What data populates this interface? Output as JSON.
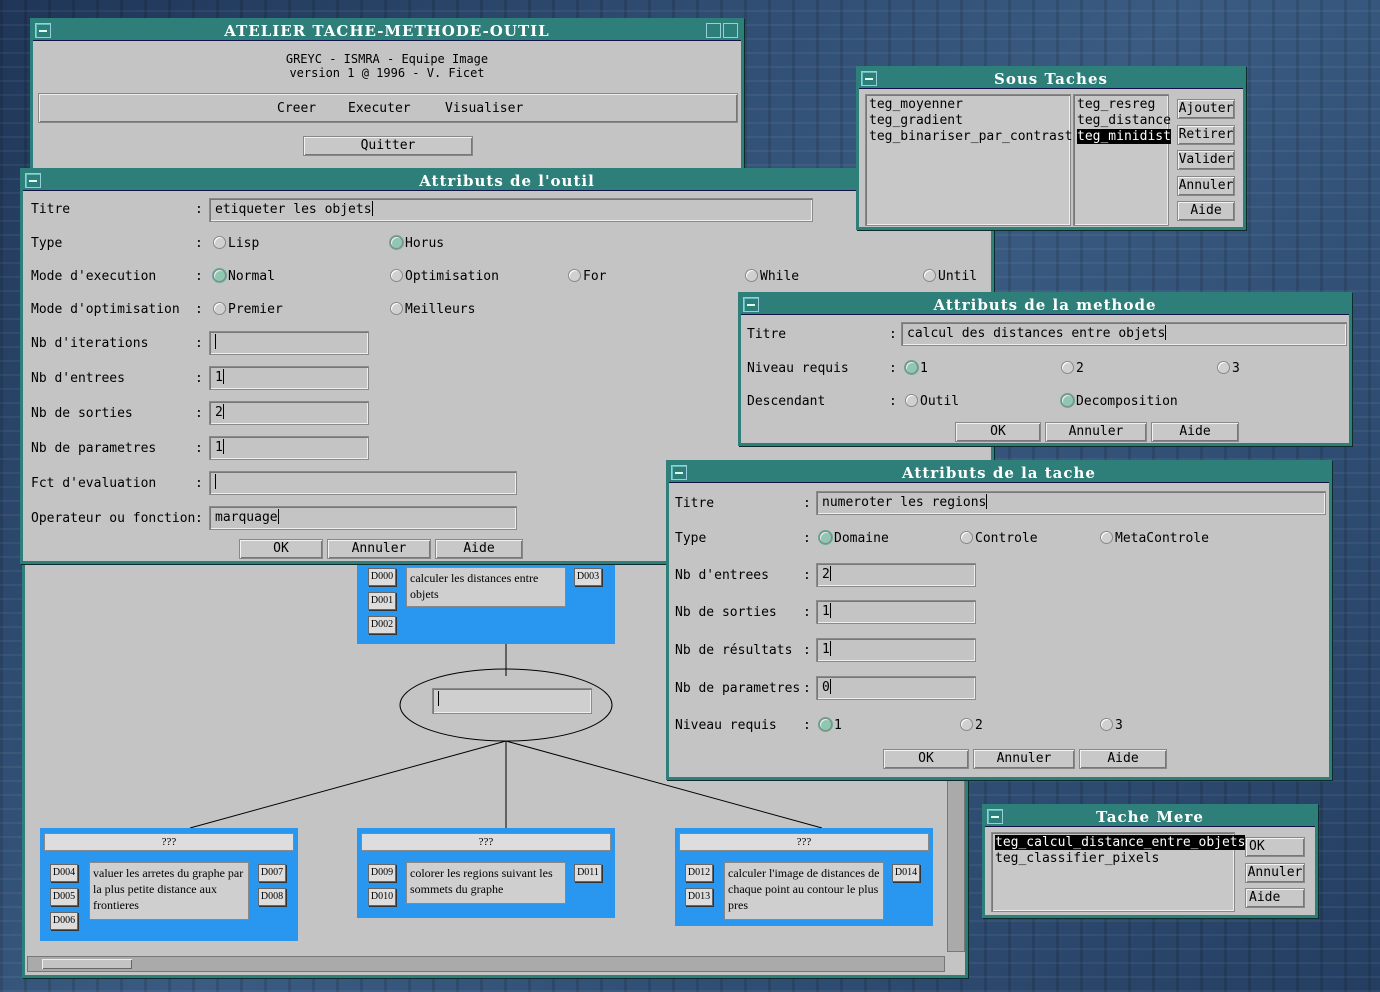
{
  "main_window": {
    "title": "ATELIER TACHE-METHODE-OUTIL",
    "line1": "GREYC - ISMRA - Equipe Image",
    "line2": "version 1 @ 1996 - V. Ficet",
    "menu": [
      "Creer",
      "Executer",
      "Visualiser"
    ],
    "quit": "Quitter"
  },
  "outil": {
    "title": "Attributs de l'outil",
    "labels": {
      "titre": "Titre",
      "type": "Type",
      "mode_exec": "Mode d'execution",
      "mode_opt": "Mode d'optimisation",
      "nb_iter": "Nb d'iterations",
      "nb_entrees": "Nb d'entrees",
      "nb_sorties": "Nb de sorties",
      "nb_params": "Nb de parametres",
      "fct_eval": "Fct d'evaluation",
      "operateur": "Operateur ou fonction"
    },
    "colon": ":",
    "values": {
      "titre": "etiqueter les objets",
      "nb_iter": "",
      "nb_entrees": "1",
      "nb_sorties": "2",
      "nb_params": "1",
      "fct_eval": "",
      "operateur": "marquage"
    },
    "type_opts": [
      "Lisp",
      "Horus"
    ],
    "exec_opts": [
      "Normal",
      "Optimisation",
      "For",
      "While",
      "Until"
    ],
    "opt_opts": [
      "Premier",
      "Meilleurs"
    ],
    "buttons": [
      "OK",
      "Annuler",
      "Aide"
    ]
  },
  "sous_taches": {
    "title": "Sous Taches",
    "left": [
      "teg_moyenner",
      "teg_gradient",
      "teg_binariser_par_contraste"
    ],
    "right": [
      "teg_resreg",
      "teg_distance",
      "teg_minidist"
    ],
    "buttons": [
      "Ajouter",
      "Retirer",
      "Valider",
      "Annuler",
      "Aide"
    ]
  },
  "methode": {
    "title": "Attributs de la methode",
    "labels": {
      "titre": "Titre",
      "niveau": "Niveau requis",
      "descendant": "Descendant"
    },
    "titre": "calcul des distances entre objets",
    "niveau_opts": [
      "1",
      "2",
      "3"
    ],
    "desc_opts": [
      "Outil",
      "Decomposition"
    ],
    "buttons": [
      "OK",
      "Annuler",
      "Aide"
    ]
  },
  "tache": {
    "title": "Attributs de la tache",
    "labels": {
      "titre": "Titre",
      "type": "Type",
      "nb_entrees": "Nb d'entrees",
      "nb_sorties": "Nb de sorties",
      "nb_resultats": "Nb de résultats",
      "nb_params": "Nb de parametres",
      "niveau": "Niveau requis"
    },
    "values": {
      "titre": "numeroter les regions",
      "nb_entrees": "2",
      "nb_sorties": "1",
      "nb_resultats": "1",
      "nb_params": "0"
    },
    "type_opts": [
      "Domaine",
      "Controle",
      "MetaControle"
    ],
    "niveau_opts": [
      "1",
      "2",
      "3"
    ],
    "buttons": [
      "OK",
      "Annuler",
      "Aide"
    ]
  },
  "tache_mere": {
    "title": "Tache Mere",
    "items": [
      "teg_calcul_distance_entre_objets",
      "teg_classifier_pixels"
    ],
    "buttons": [
      "OK",
      "Annuler",
      "Aide"
    ]
  },
  "graph": {
    "top": {
      "text": "calculer les distances entre objets",
      "inputs": [
        "D000",
        "D001",
        "D002"
      ],
      "output": "D003"
    },
    "nodes": [
      {
        "q": "???",
        "text": "valuer les arretes du graphe par la plus petite distance aux frontieres",
        "inputs": [
          "D004",
          "D005",
          "D006"
        ],
        "outputs": [
          "D007",
          "D008"
        ]
      },
      {
        "q": "???",
        "text": "colorer les regions suivant les sommets du graphe",
        "inputs": [
          "D009",
          "D010"
        ],
        "outputs": [
          "D011"
        ]
      },
      {
        "q": "???",
        "text": "calculer l'image de distances de chaque point au contour le plus pres",
        "inputs": [
          "D012",
          "D013"
        ],
        "outputs": [
          "D014"
        ]
      }
    ]
  }
}
